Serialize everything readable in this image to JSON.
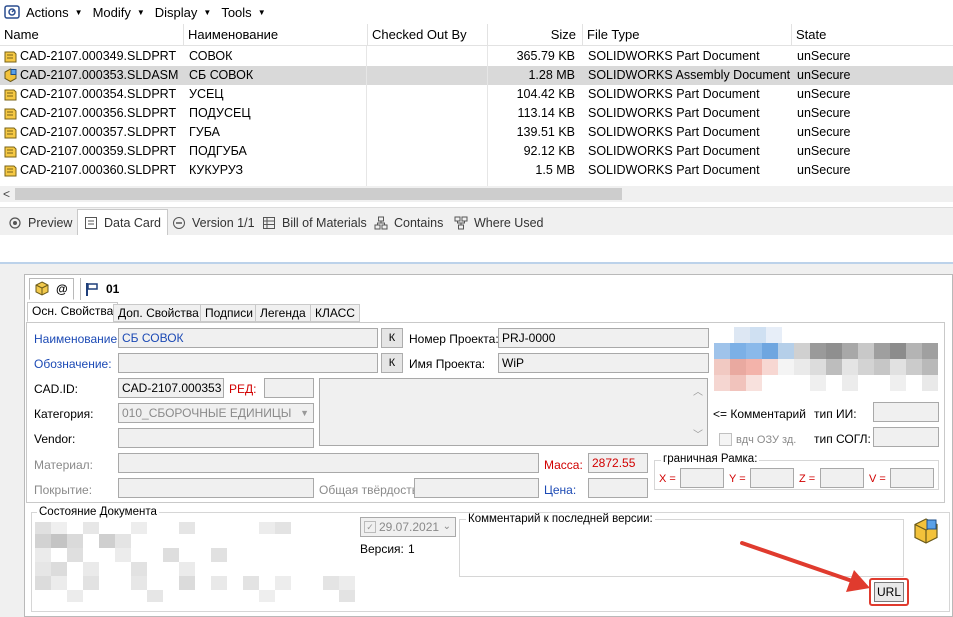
{
  "menu": {
    "actions": "Actions",
    "modify": "Modify",
    "display": "Display",
    "tools": "Tools"
  },
  "columns": {
    "name": "Name",
    "naim": "Наименование",
    "checked": "Checked Out By",
    "size": "Size",
    "type": "File Type",
    "state": "State"
  },
  "files": [
    {
      "name": "CAD-2107.000349.SLDPRT",
      "naim": "СОВОК",
      "size": "365.79 KB",
      "type": "SOLIDWORKS Part Document",
      "state": "unSecure",
      "kind": "part",
      "selected": false
    },
    {
      "name": "CAD-2107.000353.SLDASM",
      "naim": "СБ СОВОК",
      "size": "1.28 MB",
      "type": "SOLIDWORKS Assembly Document",
      "state": "unSecure",
      "kind": "assembly",
      "selected": true
    },
    {
      "name": "CAD-2107.000354.SLDPRT",
      "naim": "УСЕЦ",
      "size": "104.42 KB",
      "type": "SOLIDWORKS Part Document",
      "state": "unSecure",
      "kind": "part",
      "selected": false
    },
    {
      "name": "CAD-2107.000356.SLDPRT",
      "naim": "ПОДУСЕЦ",
      "size": "113.14 KB",
      "type": "SOLIDWORKS Part Document",
      "state": "unSecure",
      "kind": "part",
      "selected": false
    },
    {
      "name": "CAD-2107.000357.SLDPRT",
      "naim": "ГУБА",
      "size": "139.51 KB",
      "type": "SOLIDWORKS Part Document",
      "state": "unSecure",
      "kind": "part",
      "selected": false
    },
    {
      "name": "CAD-2107.000359.SLDPRT",
      "naim": "ПОДГУБА",
      "size": "92.12 KB",
      "type": "SOLIDWORKS Part Document",
      "state": "unSecure",
      "kind": "part",
      "selected": false
    },
    {
      "name": "CAD-2107.000360.SLDPRT",
      "naim": "КУКУРУЗ",
      "size": "1.5 MB",
      "type": "SOLIDWORKS Part Document",
      "state": "unSecure",
      "kind": "part",
      "selected": false
    }
  ],
  "scroll_left": "<",
  "view_tabs": {
    "preview": "Preview",
    "datacard": "Data Card",
    "version": "Version 1/1",
    "bom": "Bill of Materials",
    "contains": "Contains",
    "whereused": "Where Used"
  },
  "config_tabs": {
    "at": "@",
    "c01": "01"
  },
  "subtabs": {
    "main": "Осн. Свойства",
    "extra": "Доп. Свойства",
    "sign": "Подписи",
    "legend": "Легенда",
    "klass": "КЛАСС"
  },
  "form": {
    "naim_label": "Наименование:",
    "naim_value": "СБ СОВОК",
    "oboz_label": "Обозначение:",
    "oboz_value": "",
    "k_label": "К",
    "proj_no_label": "Номер Проекта:",
    "proj_no_value": "PRJ-0000",
    "proj_name_label": "Имя Проекта:",
    "proj_name_value": "WiP",
    "cadid_label": "CAD.ID:",
    "cadid_value": "CAD-2107.000353",
    "red_label": "РЕД:",
    "category_label": "Категория:",
    "category_value": "010_СБОРОЧНЫЕ ЕДИНИЦЫ",
    "vendor_label": "Vendor:",
    "material_label": "Материал:",
    "mass_label": "Масса:",
    "mass_value": "2872.55",
    "pokrytie_label": "Покрытие:",
    "hardness_label": "Общая твёрдость:",
    "price_label": "Цена:",
    "comment_label": "<= Комментарий",
    "tip_ii_label": "тип ИИ:",
    "tip_sogl_label": "тип СОГЛ:",
    "vdch_label": "вдч ОЗУ зд.",
    "bbox_legend": "граничная Рамка:",
    "x_label": "X =",
    "y_label": "Y =",
    "z_label": "Z =",
    "v_label": "V ="
  },
  "state_section": {
    "title": "Состояние Документа",
    "date": "29.07.2021",
    "version_label": "Версия:",
    "version_value": "1",
    "comment_title": "Комментарий к последней версии:",
    "url_button": "URL"
  },
  "colors": {
    "accent_blue": "#1c4ab5",
    "required_red": "#d10000",
    "annotation_red": "#e03b2e",
    "selection_gray": "#d9d9d9"
  }
}
